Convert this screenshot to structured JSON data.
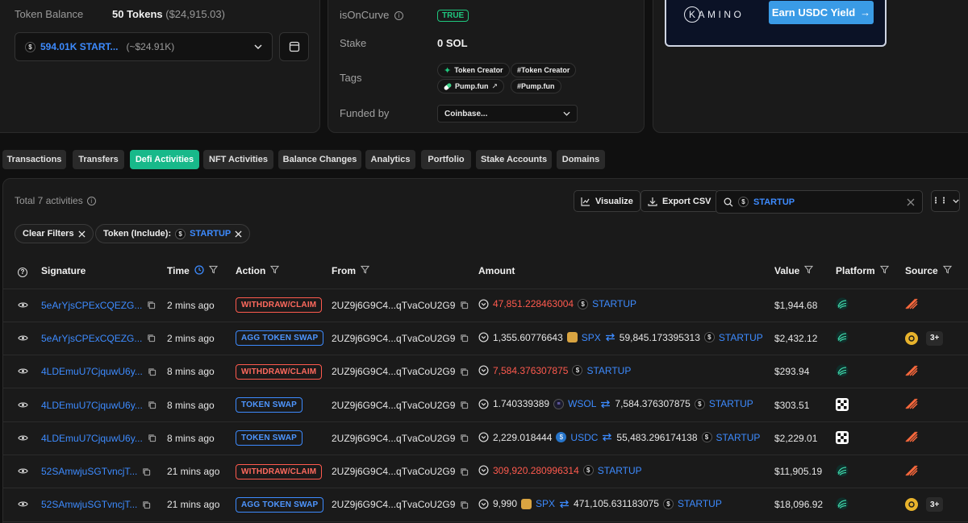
{
  "balance": {
    "label": "Token Balance",
    "tokens": "50 Tokens",
    "usd": "($24,915.03)",
    "selected_token": "594.01K START...",
    "selected_usd": "(~$24.91K)"
  },
  "info": {
    "is_on_curve_label": "isOnCurve",
    "is_on_curve_value": "TRUE",
    "stake_label": "Stake",
    "stake_value": "0 SOL",
    "tags_label": "Tags",
    "tags": [
      "Token Creator",
      "#Token Creator",
      "Pump.fun",
      "#Pump.fun"
    ],
    "funded_label": "Funded by",
    "funded_value": "Coinbase..."
  },
  "ad": {
    "logo_text": "KAMINO",
    "cta": "Earn USDC Yield"
  },
  "tabs": [
    "Transactions",
    "Transfers",
    "Defi Activities",
    "NFT Activities",
    "Balance Changes",
    "Analytics",
    "Portfolio",
    "Stake Accounts",
    "Domains"
  ],
  "toolbar": {
    "total": "Total 7 activities",
    "visualize": "Visualize",
    "export": "Export CSV",
    "search_value": "STARTUP"
  },
  "filters": {
    "clear": "Clear Filters",
    "token_label": "Token (Include):",
    "token_value": "STARTUP"
  },
  "table": {
    "headers": [
      "Signature",
      "Time",
      "Action",
      "From",
      "Amount",
      "Value",
      "Platform",
      "Source"
    ],
    "rows": [
      {
        "sig": "5eArYjsCPExCQEZG...",
        "time": "2 mins ago",
        "action": "WITHDRAW/CLAIM",
        "from": "2UZ9j6G9C4...qTvaCoU2G9",
        "amt1": "47,851.228463004",
        "tok1": "STARTUP",
        "amt2": "",
        "tok2": "",
        "value": "$1,944.68"
      },
      {
        "sig": "5eArYjsCPExCQEZG...",
        "time": "2 mins ago",
        "action": "AGG TOKEN SWAP",
        "from": "2UZ9j6G9C4...qTvaCoU2G9",
        "amt1": "1,355.60776643",
        "tok1": "SPX",
        "amt2": "59,845.173395313",
        "tok2": "STARTUP",
        "value": "$2,432.12",
        "source_extra": "3+"
      },
      {
        "sig": "4LDEmuU7CjquwU6y...",
        "time": "8 mins ago",
        "action": "WITHDRAW/CLAIM",
        "from": "2UZ9j6G9C4...qTvaCoU2G9",
        "amt1": "7,584.376307875",
        "tok1": "STARTUP",
        "amt2": "",
        "tok2": "",
        "value": "$293.94"
      },
      {
        "sig": "4LDEmuU7CjquwU6y...",
        "time": "8 mins ago",
        "action": "TOKEN SWAP",
        "from": "2UZ9j6G9C4...qTvaCoU2G9",
        "amt1": "1.740339389",
        "tok1": "WSOL",
        "amt2": "7,584.376307875",
        "tok2": "STARTUP",
        "value": "$303.51"
      },
      {
        "sig": "4LDEmuU7CjquwU6y...",
        "time": "8 mins ago",
        "action": "TOKEN SWAP",
        "from": "2UZ9j6G9C4...qTvaCoU2G9",
        "amt1": "2,229.018444",
        "tok1": "USDC",
        "amt2": "55,483.296174138",
        "tok2": "STARTUP",
        "value": "$2,229.01"
      },
      {
        "sig": "52SAmwjuSGTvncjT...",
        "time": "21 mins ago",
        "action": "WITHDRAW/CLAIM",
        "from": "2UZ9j6G9C4...qTvaCoU2G9",
        "amt1": "309,920.280996314",
        "tok1": "STARTUP",
        "amt2": "",
        "tok2": "",
        "value": "$11,905.19"
      },
      {
        "sig": "52SAmwjuSGTvncjT...",
        "time": "21 mins ago",
        "action": "AGG TOKEN SWAP",
        "from": "2UZ9j6G9C4...qTvaCoU2G9",
        "amt1": "9,990",
        "tok1": "SPX",
        "amt2": "471,105.631183075",
        "tok2": "STARTUP",
        "value": "$18,096.92",
        "source_extra": "3+"
      }
    ]
  },
  "colors": {
    "accent": "#18b98a",
    "link": "#3d8bff",
    "red": "#ff5a4e"
  }
}
